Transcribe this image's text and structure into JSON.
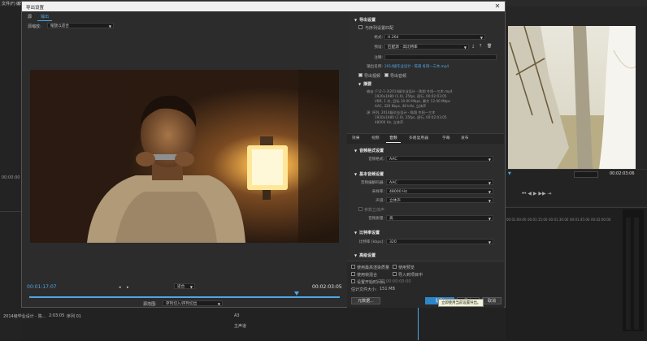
{
  "menubar": {
    "items": [
      "文件(F)",
      "编辑(E)"
    ]
  },
  "dialog": {
    "title": "导出设置",
    "tabs": [
      "源",
      "输出"
    ],
    "source_scaling_label": "源缩放:",
    "source_scaling_value": "缩放以适合",
    "timecode_current": "00:01:17:07",
    "timecode_end": "00:02:03:05",
    "fit_label": "适合",
    "range_label": "源范围:",
    "range_value": "序列切入/序列切出"
  },
  "export_settings": {
    "header": "导出设置",
    "match_sequence": "与序列设置匹配",
    "format_label": "格式:",
    "format_value": "H.264",
    "preset_label": "预设:",
    "preset_value": "匹配源 - 高比特率",
    "comments_label": "注释:",
    "output_name_label": "输出名称:",
    "output_name_value": "2014级毕业设计 - 陈翔 冬阳—三木.mp4",
    "export_video": "导出视频",
    "export_audio": "导出音频",
    "summary_header": "摘要",
    "output_summary": [
      "输出: F:\\2-1-3\\2014级毕业设计 - 陈翔 冬阳—三木.mp4",
      "1920x1080 (1.0), 25fps, 逐行, 00:02:03:05",
      "VBR, 1 次, 目标 10.00 Mbps, 最大 12.00 Mbps",
      "AAC, 320 Kbps, 48 kHz, 立体声"
    ],
    "source_summary": [
      "源: 序列, 2014级毕业设计 - 陈翔 冬阳—三木",
      "1920x1080 (1.0), 25fps, 逐行, 00:02:03:05",
      "48000 Hz, 立体声"
    ]
  },
  "right_tabs": [
    "效果",
    "视频",
    "音频",
    "多路复用器",
    "字幕",
    "发布"
  ],
  "audio_format": {
    "header": "音频格式设置",
    "label": "音频格式:",
    "value": "AAC"
  },
  "basic_audio": {
    "header": "基本音频设置",
    "codec_label": "音频编解码器:",
    "codec_value": "AAC",
    "sample_rate_label": "采样率:",
    "sample_rate_value": "48000 Hz",
    "channels_label": "声道:",
    "channels_value": "立体声",
    "parametric": "参数立体声",
    "quality_label": "音频质量:",
    "quality_value": "高"
  },
  "bitrate": {
    "header": "比特率设置",
    "label": "比特率 [kbps]:",
    "value": "320"
  },
  "advanced": {
    "header": "高级设置"
  },
  "bottom_options": {
    "max_render": "使用最高渲染质量",
    "use_previews": "使用预览",
    "frame_blend": "使用帧混合",
    "import_project": "导入到项目中",
    "set_start_tc": "设置开始时间码",
    "start_tc_value": "00:00:00:00",
    "file_size_label": "估计文件大小:",
    "file_size_value": "151 MB"
  },
  "buttons": {
    "metadata": "元数据...",
    "queue": "队列",
    "export": "导出",
    "cancel": "取消"
  },
  "tooltip": "立即使用当前设置导出。",
  "background": {
    "left_timecode": "00:00:00",
    "right_timecode": "00:02:03:06",
    "timeline_sequence": "2014级毕业设计 - 陈...",
    "timeline_duration": "2:03:05",
    "timeline_seq2": "序列 01",
    "track_a3": "A3",
    "track_master": "主声道",
    "ruler_ticks": [
      "00:01:00:00",
      "00:01:15:00",
      "00:01:30:00",
      "00:01:45:00",
      "00:02:00:00",
      "00:02:15:00"
    ]
  }
}
